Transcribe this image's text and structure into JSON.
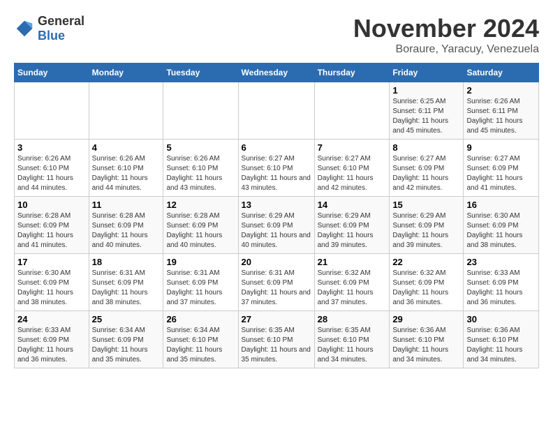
{
  "logo": {
    "text_general": "General",
    "text_blue": "Blue"
  },
  "title": {
    "month": "November 2024",
    "location": "Boraure, Yaracuy, Venezuela"
  },
  "weekdays": [
    "Sunday",
    "Monday",
    "Tuesday",
    "Wednesday",
    "Thursday",
    "Friday",
    "Saturday"
  ],
  "weeks": [
    [
      {
        "day": "",
        "info": ""
      },
      {
        "day": "",
        "info": ""
      },
      {
        "day": "",
        "info": ""
      },
      {
        "day": "",
        "info": ""
      },
      {
        "day": "",
        "info": ""
      },
      {
        "day": "1",
        "info": "Sunrise: 6:25 AM\nSunset: 6:11 PM\nDaylight: 11 hours and 45 minutes."
      },
      {
        "day": "2",
        "info": "Sunrise: 6:26 AM\nSunset: 6:11 PM\nDaylight: 11 hours and 45 minutes."
      }
    ],
    [
      {
        "day": "3",
        "info": "Sunrise: 6:26 AM\nSunset: 6:10 PM\nDaylight: 11 hours and 44 minutes."
      },
      {
        "day": "4",
        "info": "Sunrise: 6:26 AM\nSunset: 6:10 PM\nDaylight: 11 hours and 44 minutes."
      },
      {
        "day": "5",
        "info": "Sunrise: 6:26 AM\nSunset: 6:10 PM\nDaylight: 11 hours and 43 minutes."
      },
      {
        "day": "6",
        "info": "Sunrise: 6:27 AM\nSunset: 6:10 PM\nDaylight: 11 hours and 43 minutes."
      },
      {
        "day": "7",
        "info": "Sunrise: 6:27 AM\nSunset: 6:10 PM\nDaylight: 11 hours and 42 minutes."
      },
      {
        "day": "8",
        "info": "Sunrise: 6:27 AM\nSunset: 6:09 PM\nDaylight: 11 hours and 42 minutes."
      },
      {
        "day": "9",
        "info": "Sunrise: 6:27 AM\nSunset: 6:09 PM\nDaylight: 11 hours and 41 minutes."
      }
    ],
    [
      {
        "day": "10",
        "info": "Sunrise: 6:28 AM\nSunset: 6:09 PM\nDaylight: 11 hours and 41 minutes."
      },
      {
        "day": "11",
        "info": "Sunrise: 6:28 AM\nSunset: 6:09 PM\nDaylight: 11 hours and 40 minutes."
      },
      {
        "day": "12",
        "info": "Sunrise: 6:28 AM\nSunset: 6:09 PM\nDaylight: 11 hours and 40 minutes."
      },
      {
        "day": "13",
        "info": "Sunrise: 6:29 AM\nSunset: 6:09 PM\nDaylight: 11 hours and 40 minutes."
      },
      {
        "day": "14",
        "info": "Sunrise: 6:29 AM\nSunset: 6:09 PM\nDaylight: 11 hours and 39 minutes."
      },
      {
        "day": "15",
        "info": "Sunrise: 6:29 AM\nSunset: 6:09 PM\nDaylight: 11 hours and 39 minutes."
      },
      {
        "day": "16",
        "info": "Sunrise: 6:30 AM\nSunset: 6:09 PM\nDaylight: 11 hours and 38 minutes."
      }
    ],
    [
      {
        "day": "17",
        "info": "Sunrise: 6:30 AM\nSunset: 6:09 PM\nDaylight: 11 hours and 38 minutes."
      },
      {
        "day": "18",
        "info": "Sunrise: 6:31 AM\nSunset: 6:09 PM\nDaylight: 11 hours and 38 minutes."
      },
      {
        "day": "19",
        "info": "Sunrise: 6:31 AM\nSunset: 6:09 PM\nDaylight: 11 hours and 37 minutes."
      },
      {
        "day": "20",
        "info": "Sunrise: 6:31 AM\nSunset: 6:09 PM\nDaylight: 11 hours and 37 minutes."
      },
      {
        "day": "21",
        "info": "Sunrise: 6:32 AM\nSunset: 6:09 PM\nDaylight: 11 hours and 37 minutes."
      },
      {
        "day": "22",
        "info": "Sunrise: 6:32 AM\nSunset: 6:09 PM\nDaylight: 11 hours and 36 minutes."
      },
      {
        "day": "23",
        "info": "Sunrise: 6:33 AM\nSunset: 6:09 PM\nDaylight: 11 hours and 36 minutes."
      }
    ],
    [
      {
        "day": "24",
        "info": "Sunrise: 6:33 AM\nSunset: 6:09 PM\nDaylight: 11 hours and 36 minutes."
      },
      {
        "day": "25",
        "info": "Sunrise: 6:34 AM\nSunset: 6:09 PM\nDaylight: 11 hours and 35 minutes."
      },
      {
        "day": "26",
        "info": "Sunrise: 6:34 AM\nSunset: 6:10 PM\nDaylight: 11 hours and 35 minutes."
      },
      {
        "day": "27",
        "info": "Sunrise: 6:35 AM\nSunset: 6:10 PM\nDaylight: 11 hours and 35 minutes."
      },
      {
        "day": "28",
        "info": "Sunrise: 6:35 AM\nSunset: 6:10 PM\nDaylight: 11 hours and 34 minutes."
      },
      {
        "day": "29",
        "info": "Sunrise: 6:36 AM\nSunset: 6:10 PM\nDaylight: 11 hours and 34 minutes."
      },
      {
        "day": "30",
        "info": "Sunrise: 6:36 AM\nSunset: 6:10 PM\nDaylight: 11 hours and 34 minutes."
      }
    ]
  ]
}
